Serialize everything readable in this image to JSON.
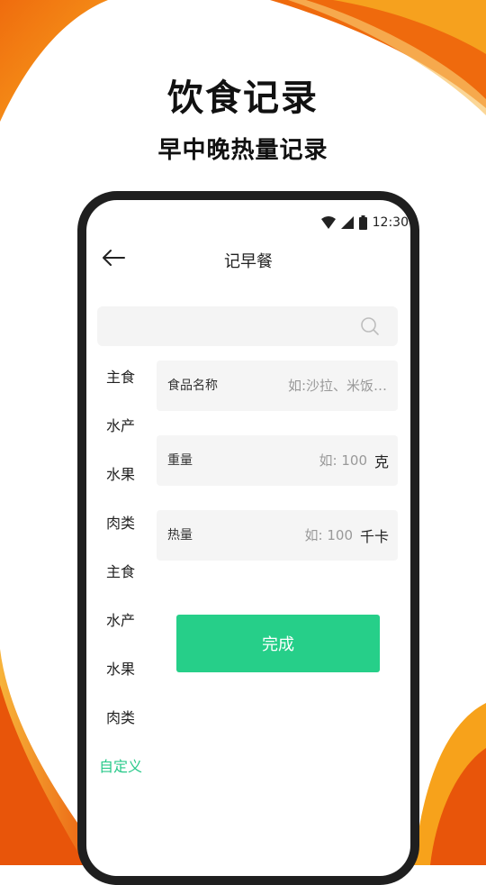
{
  "promo": {
    "title": "饮食记录",
    "subtitle": "早中晚热量记录"
  },
  "status_bar": {
    "time": "12:30",
    "icons": [
      "wifi-icon",
      "cellular-signal-icon",
      "battery-icon"
    ]
  },
  "nav": {
    "title": "记早餐",
    "back_icon": "arrow-left-icon"
  },
  "search": {
    "value": "",
    "placeholder": "",
    "icon": "search-icon"
  },
  "categories": [
    {
      "label": "主食",
      "active": false
    },
    {
      "label": "水产",
      "active": false
    },
    {
      "label": "水果",
      "active": false
    },
    {
      "label": "肉类",
      "active": false
    },
    {
      "label": "主食",
      "active": false
    },
    {
      "label": "水产",
      "active": false
    },
    {
      "label": "水果",
      "active": false
    },
    {
      "label": "肉类",
      "active": false
    },
    {
      "label": "自定义",
      "active": true
    }
  ],
  "form": {
    "food_name": {
      "label": "食品名称",
      "placeholder": "如:沙拉、米饭…",
      "value": ""
    },
    "weight": {
      "label": "重量",
      "placeholder": "如: 100",
      "value": "",
      "unit": "克"
    },
    "calories": {
      "label": "热量",
      "placeholder": "如: 100",
      "value": "",
      "unit": "千卡"
    }
  },
  "done_button": {
    "label": "完成"
  },
  "colors": {
    "accent_green": "#26cf89",
    "orange_light": "#f7a21b",
    "orange_dark": "#e8550a",
    "phone_frame": "#1f1f1f"
  }
}
